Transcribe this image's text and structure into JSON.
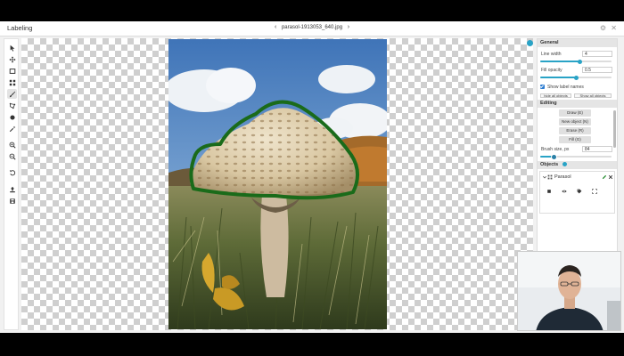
{
  "app": {
    "title": "Labeling"
  },
  "file": {
    "name": "parasol-1913053_640.jpg",
    "prev_icon": "chevron-left-icon",
    "next_icon": "chevron-right-icon"
  },
  "top_icons": {
    "settings": "⚙",
    "close": "✕"
  },
  "toolbar": {
    "tools": [
      {
        "name": "pointer",
        "icon": "cursor-icon"
      },
      {
        "name": "move",
        "icon": "move-icon"
      },
      {
        "name": "rectangle",
        "icon": "rectangle-icon"
      },
      {
        "name": "grid",
        "icon": "grid-icon"
      },
      {
        "name": "brush",
        "icon": "brush-icon",
        "active": true
      },
      {
        "name": "polygon",
        "icon": "polygon-icon"
      },
      {
        "name": "point",
        "icon": "point-icon"
      },
      {
        "name": "magic",
        "icon": "magic-wand-icon"
      },
      {
        "name": "zoom-in",
        "icon": "zoom-in-icon"
      },
      {
        "name": "zoom-out",
        "icon": "zoom-out-icon"
      },
      {
        "name": "undo",
        "icon": "undo-icon"
      },
      {
        "name": "export",
        "icon": "export-icon"
      },
      {
        "name": "save",
        "icon": "save-icon"
      }
    ]
  },
  "panel": {
    "general": {
      "title": "General",
      "line_width_label": "Line width",
      "line_width_value": "4",
      "line_width_fraction": 0.55,
      "fill_opacity_label": "Fill opacity",
      "fill_opacity_value": "0.5",
      "fill_opacity_fraction": 0.5,
      "show_label_names_label": "Show label names",
      "show_label_names_checked": true,
      "hide_all_label": "hide all objects",
      "show_all_label": "Show all objects"
    },
    "editing": {
      "title": "Editing",
      "modes": [
        "Draw (E)",
        "New object (N)",
        "Erase (R)",
        "Fill (G)"
      ],
      "brush_size_label": "Brush size, px",
      "brush_size_value": "84",
      "brush_size_fraction": 0.2
    },
    "objects": {
      "title": "Objects",
      "items": [
        {
          "label": "Parasol",
          "color": "#1f7a1f"
        }
      ]
    }
  },
  "colors": {
    "accent": "#29a3c6",
    "annotation": "#1a6b1a"
  }
}
